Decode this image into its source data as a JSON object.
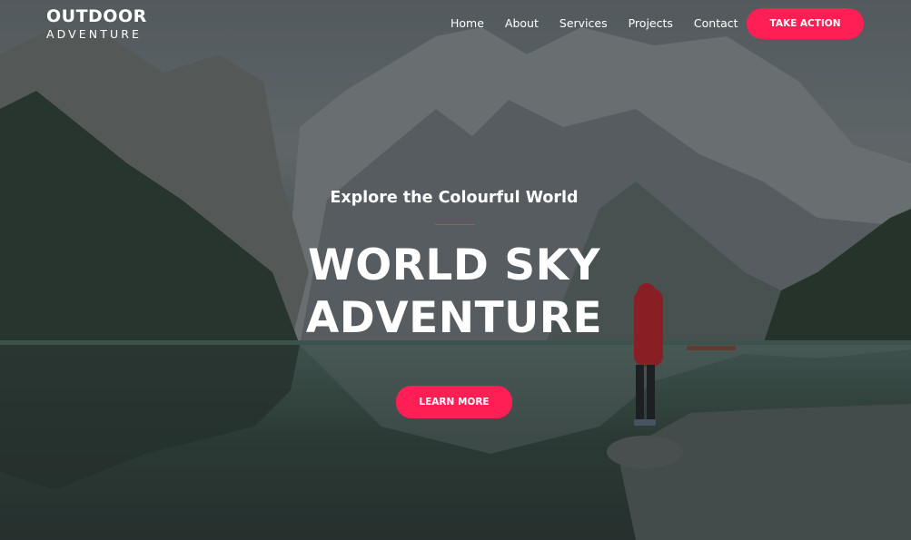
{
  "brand": {
    "name": "OUTDOOR",
    "tagline": "ADVENTURE"
  },
  "nav": {
    "items": [
      "Home",
      "About",
      "Services",
      "Projects",
      "Contact"
    ],
    "cta_label": "TAKE ACTION"
  },
  "hero": {
    "subtitle": "Explore the Colourful World",
    "title_line1": "WORLD SKY",
    "title_line2": "ADVENTURE",
    "button_label": "LEARN MORE"
  },
  "colors": {
    "accent": "#ff1f55",
    "text": "#ffffff"
  },
  "background": {
    "description_icon": "mountain-lake-photo"
  }
}
